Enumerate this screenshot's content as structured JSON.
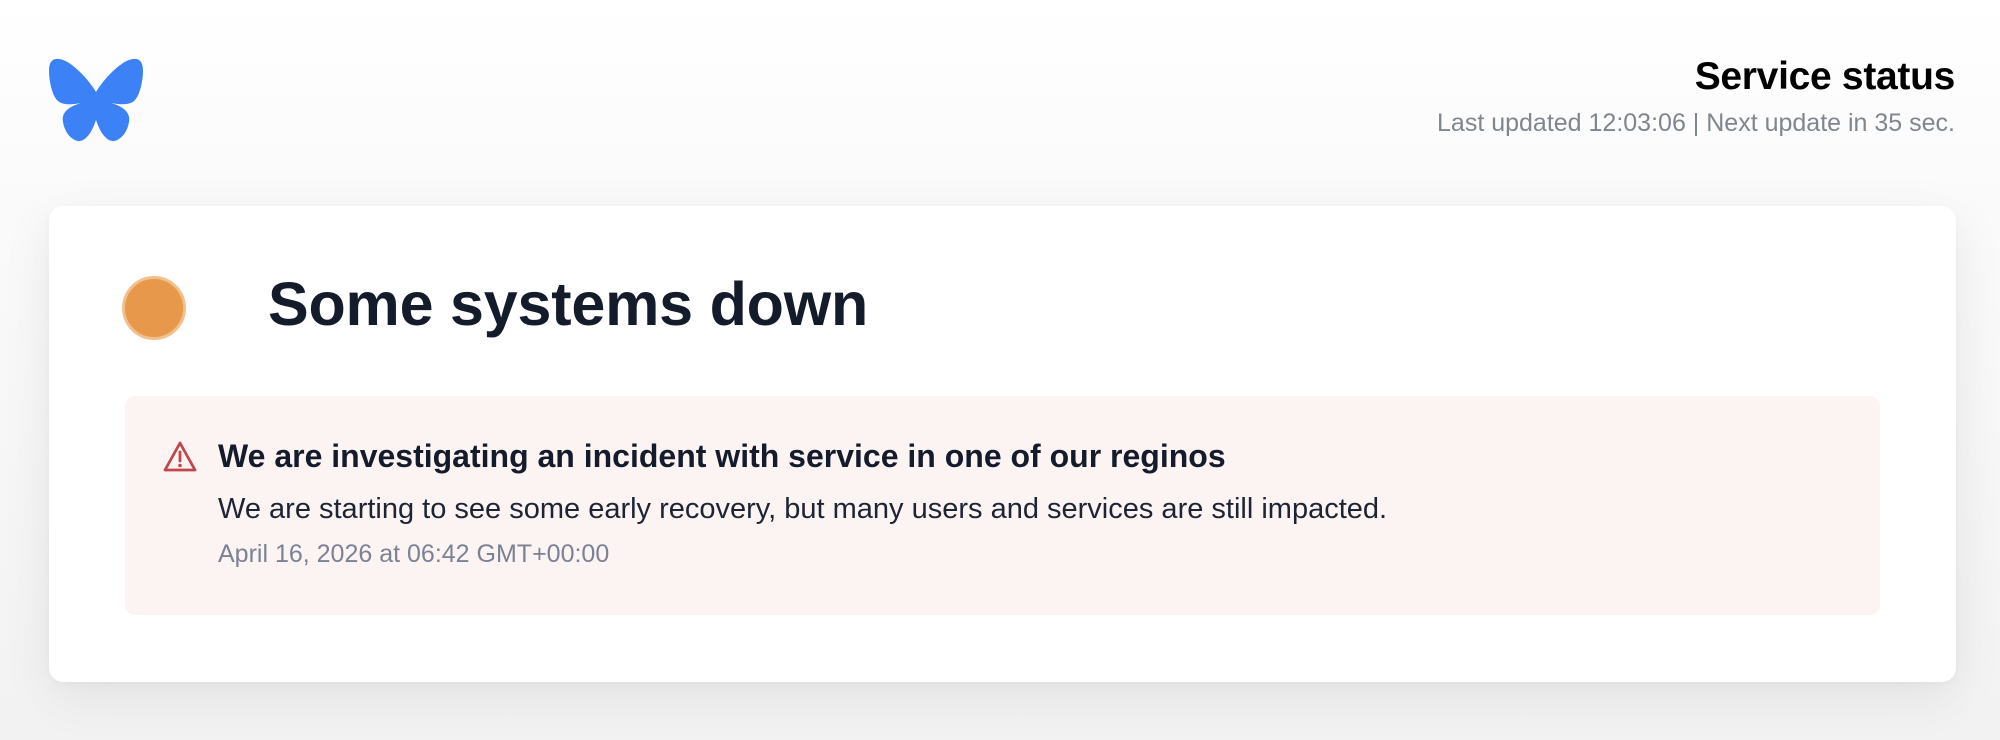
{
  "header": {
    "logo_icon": "butterfly-icon",
    "title": "Service status",
    "meta": "Last updated 12:03:06 | Next update in 35 sec."
  },
  "status": {
    "indicator_color": "#e8984a",
    "title": "Some systems down"
  },
  "incident": {
    "icon": "warning-triangle-icon",
    "title": "We are investigating an incident with service in one of our reginos",
    "body": "We are starting to see some early recovery, but many users and services are still impacted.",
    "timestamp": "April 16, 2026 at 06:42 GMT+00:00"
  },
  "colors": {
    "brand": "#3c82f6",
    "status_warning": "#e8984a",
    "incident_background": "#fcf3f3",
    "warning_icon": "#c0484c"
  }
}
